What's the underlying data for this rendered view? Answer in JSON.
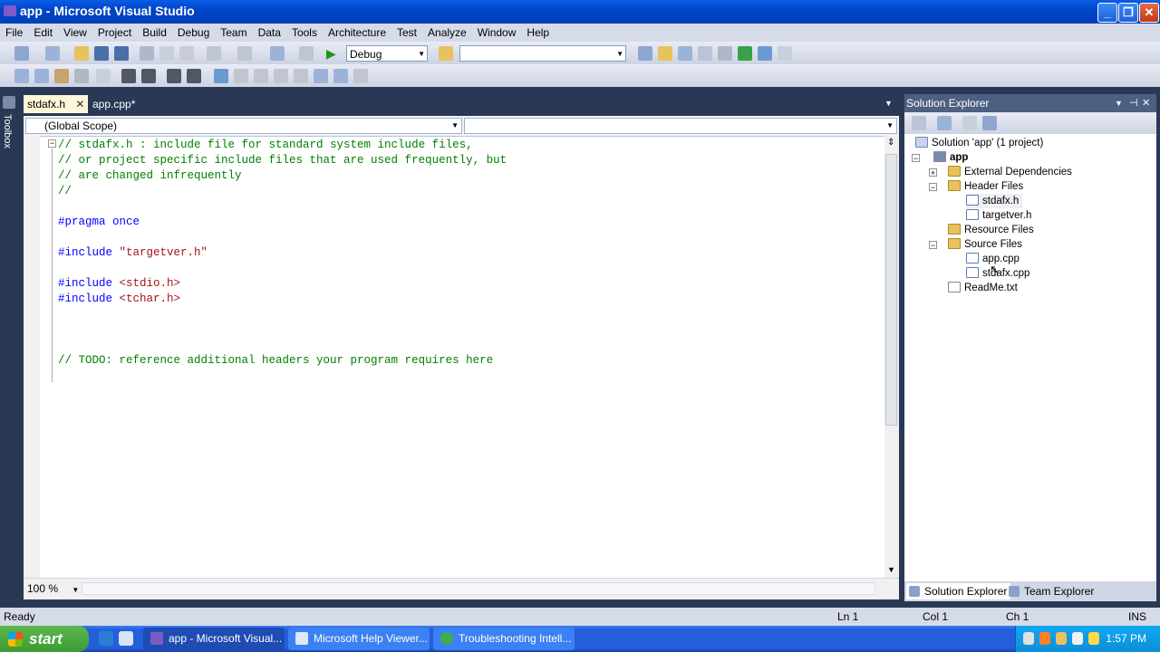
{
  "window": {
    "title": "app - Microsoft Visual Studio"
  },
  "menu": [
    "File",
    "Edit",
    "View",
    "Project",
    "Build",
    "Debug",
    "Team",
    "Data",
    "Tools",
    "Architecture",
    "Test",
    "Analyze",
    "Window",
    "Help"
  ],
  "toolbar": {
    "config": "Debug",
    "platform": ""
  },
  "toolbox_label": "Toolbox",
  "tabs": [
    {
      "label": "stdafx.h",
      "active": true
    },
    {
      "label": "app.cpp*",
      "active": false
    }
  ],
  "editor": {
    "scope": "(Global Scope)",
    "member": "",
    "zoom": "100 %",
    "lines": [
      {
        "type": "comment",
        "text": "// stdafx.h : include file for standard system include files,"
      },
      {
        "type": "comment",
        "text": "// or project specific include files that are used frequently, but"
      },
      {
        "type": "comment",
        "text": "// are changed infrequently"
      },
      {
        "type": "comment",
        "text": "//"
      },
      {
        "type": "blank",
        "text": ""
      },
      {
        "type": "pp",
        "text": "#pragma once"
      },
      {
        "type": "blank",
        "text": ""
      },
      {
        "type": "include",
        "pp": "#include",
        "arg": "\"targetver.h\""
      },
      {
        "type": "blank",
        "text": ""
      },
      {
        "type": "include",
        "pp": "#include",
        "arg": "<stdio.h>"
      },
      {
        "type": "include",
        "pp": "#include",
        "arg": "<tchar.h>"
      },
      {
        "type": "blank",
        "text": ""
      },
      {
        "type": "blank",
        "text": ""
      },
      {
        "type": "blank",
        "text": ""
      },
      {
        "type": "comment",
        "text": "// TODO: reference additional headers your program requires here"
      }
    ]
  },
  "solution_explorer": {
    "title": "Solution Explorer",
    "solution": "Solution 'app' (1 project)",
    "project": "app",
    "items": {
      "external": "External Dependencies",
      "header": "Header Files",
      "h1": "stdafx.h",
      "h2": "targetver.h",
      "resource": "Resource Files",
      "source": "Source Files",
      "s1": "app.cpp",
      "s2": "stdafx.cpp",
      "readme": "ReadMe.txt"
    },
    "tabs": [
      "Solution Explorer",
      "Team Explorer"
    ]
  },
  "status": {
    "text": "Ready",
    "ln": "Ln 1",
    "col": "Col 1",
    "ch": "Ch 1",
    "mode": "INS"
  },
  "taskbar": {
    "start": "start",
    "buttons": [
      "app - Microsoft Visual...",
      "Microsoft Help Viewer...",
      "Troubleshooting Intell..."
    ],
    "clock": "1:57 PM"
  }
}
